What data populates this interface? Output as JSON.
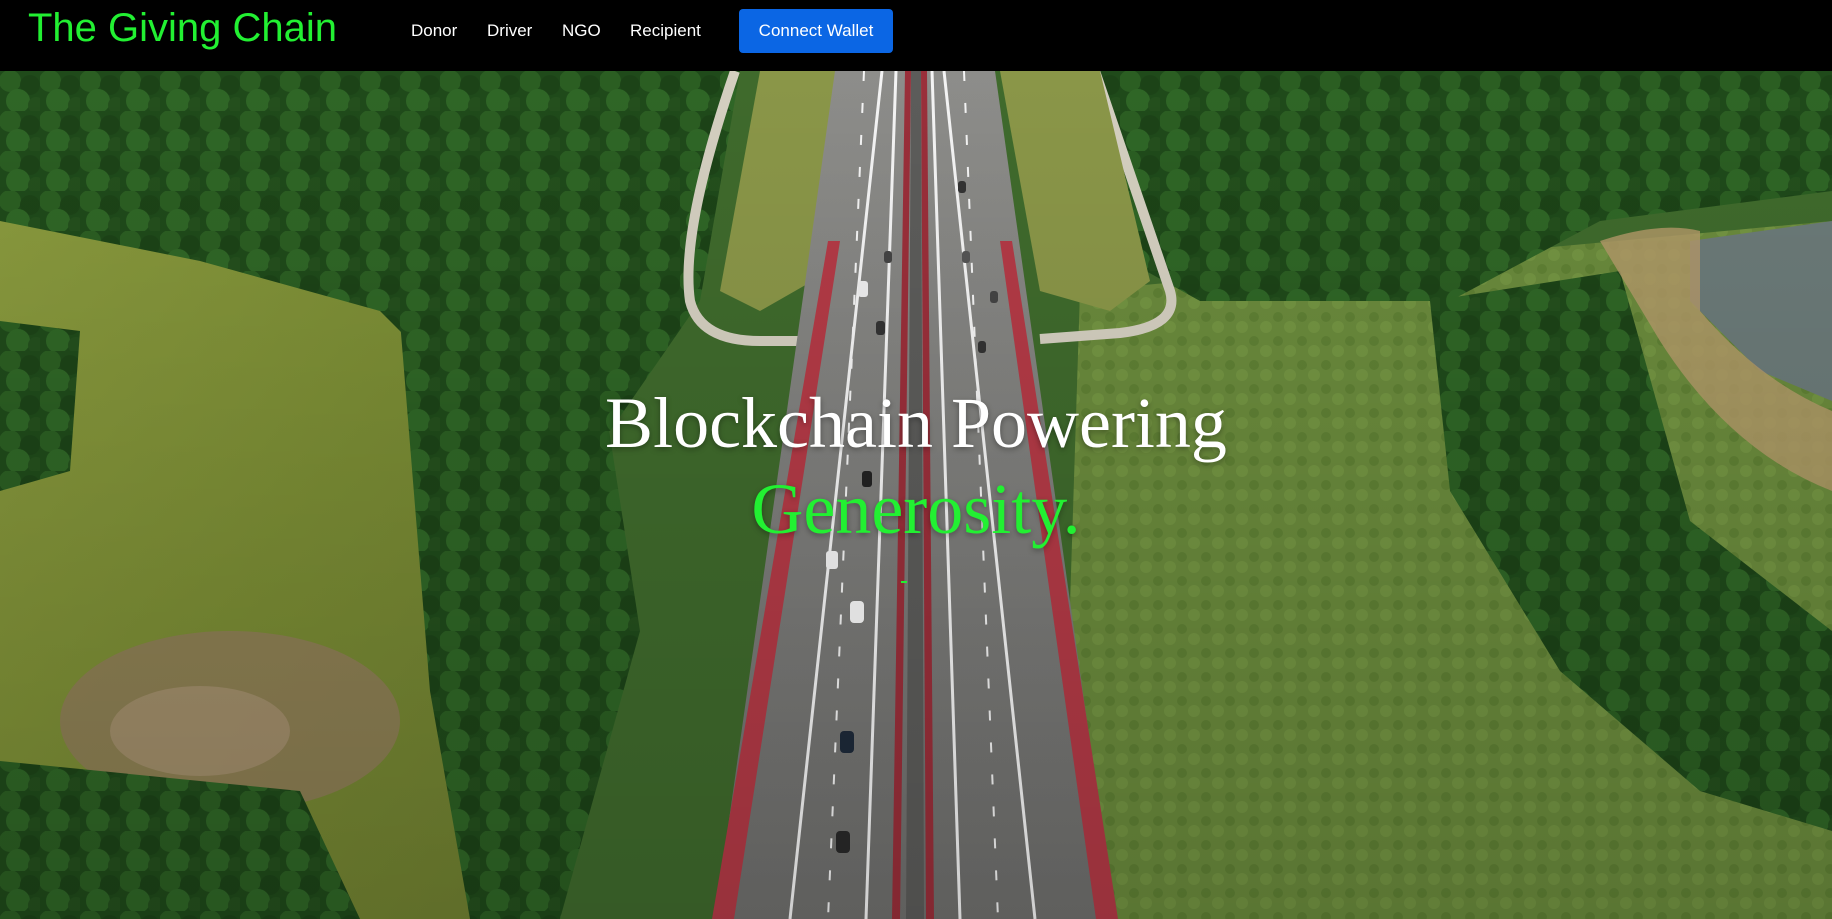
{
  "brand": {
    "name": "The Giving Chain",
    "color": "#22f032"
  },
  "nav": {
    "items": [
      {
        "label": "Donor"
      },
      {
        "label": "Driver"
      },
      {
        "label": "NGO"
      },
      {
        "label": "Recipient"
      }
    ],
    "connect_wallet_label": "Connect Wallet",
    "connect_wallet_color": "#0b66e4"
  },
  "hero": {
    "headline_line1": "Blockchain Powering",
    "headline_line2": "Generosity.",
    "accent_color": "#22f032",
    "background": "aerial-highway-video"
  }
}
